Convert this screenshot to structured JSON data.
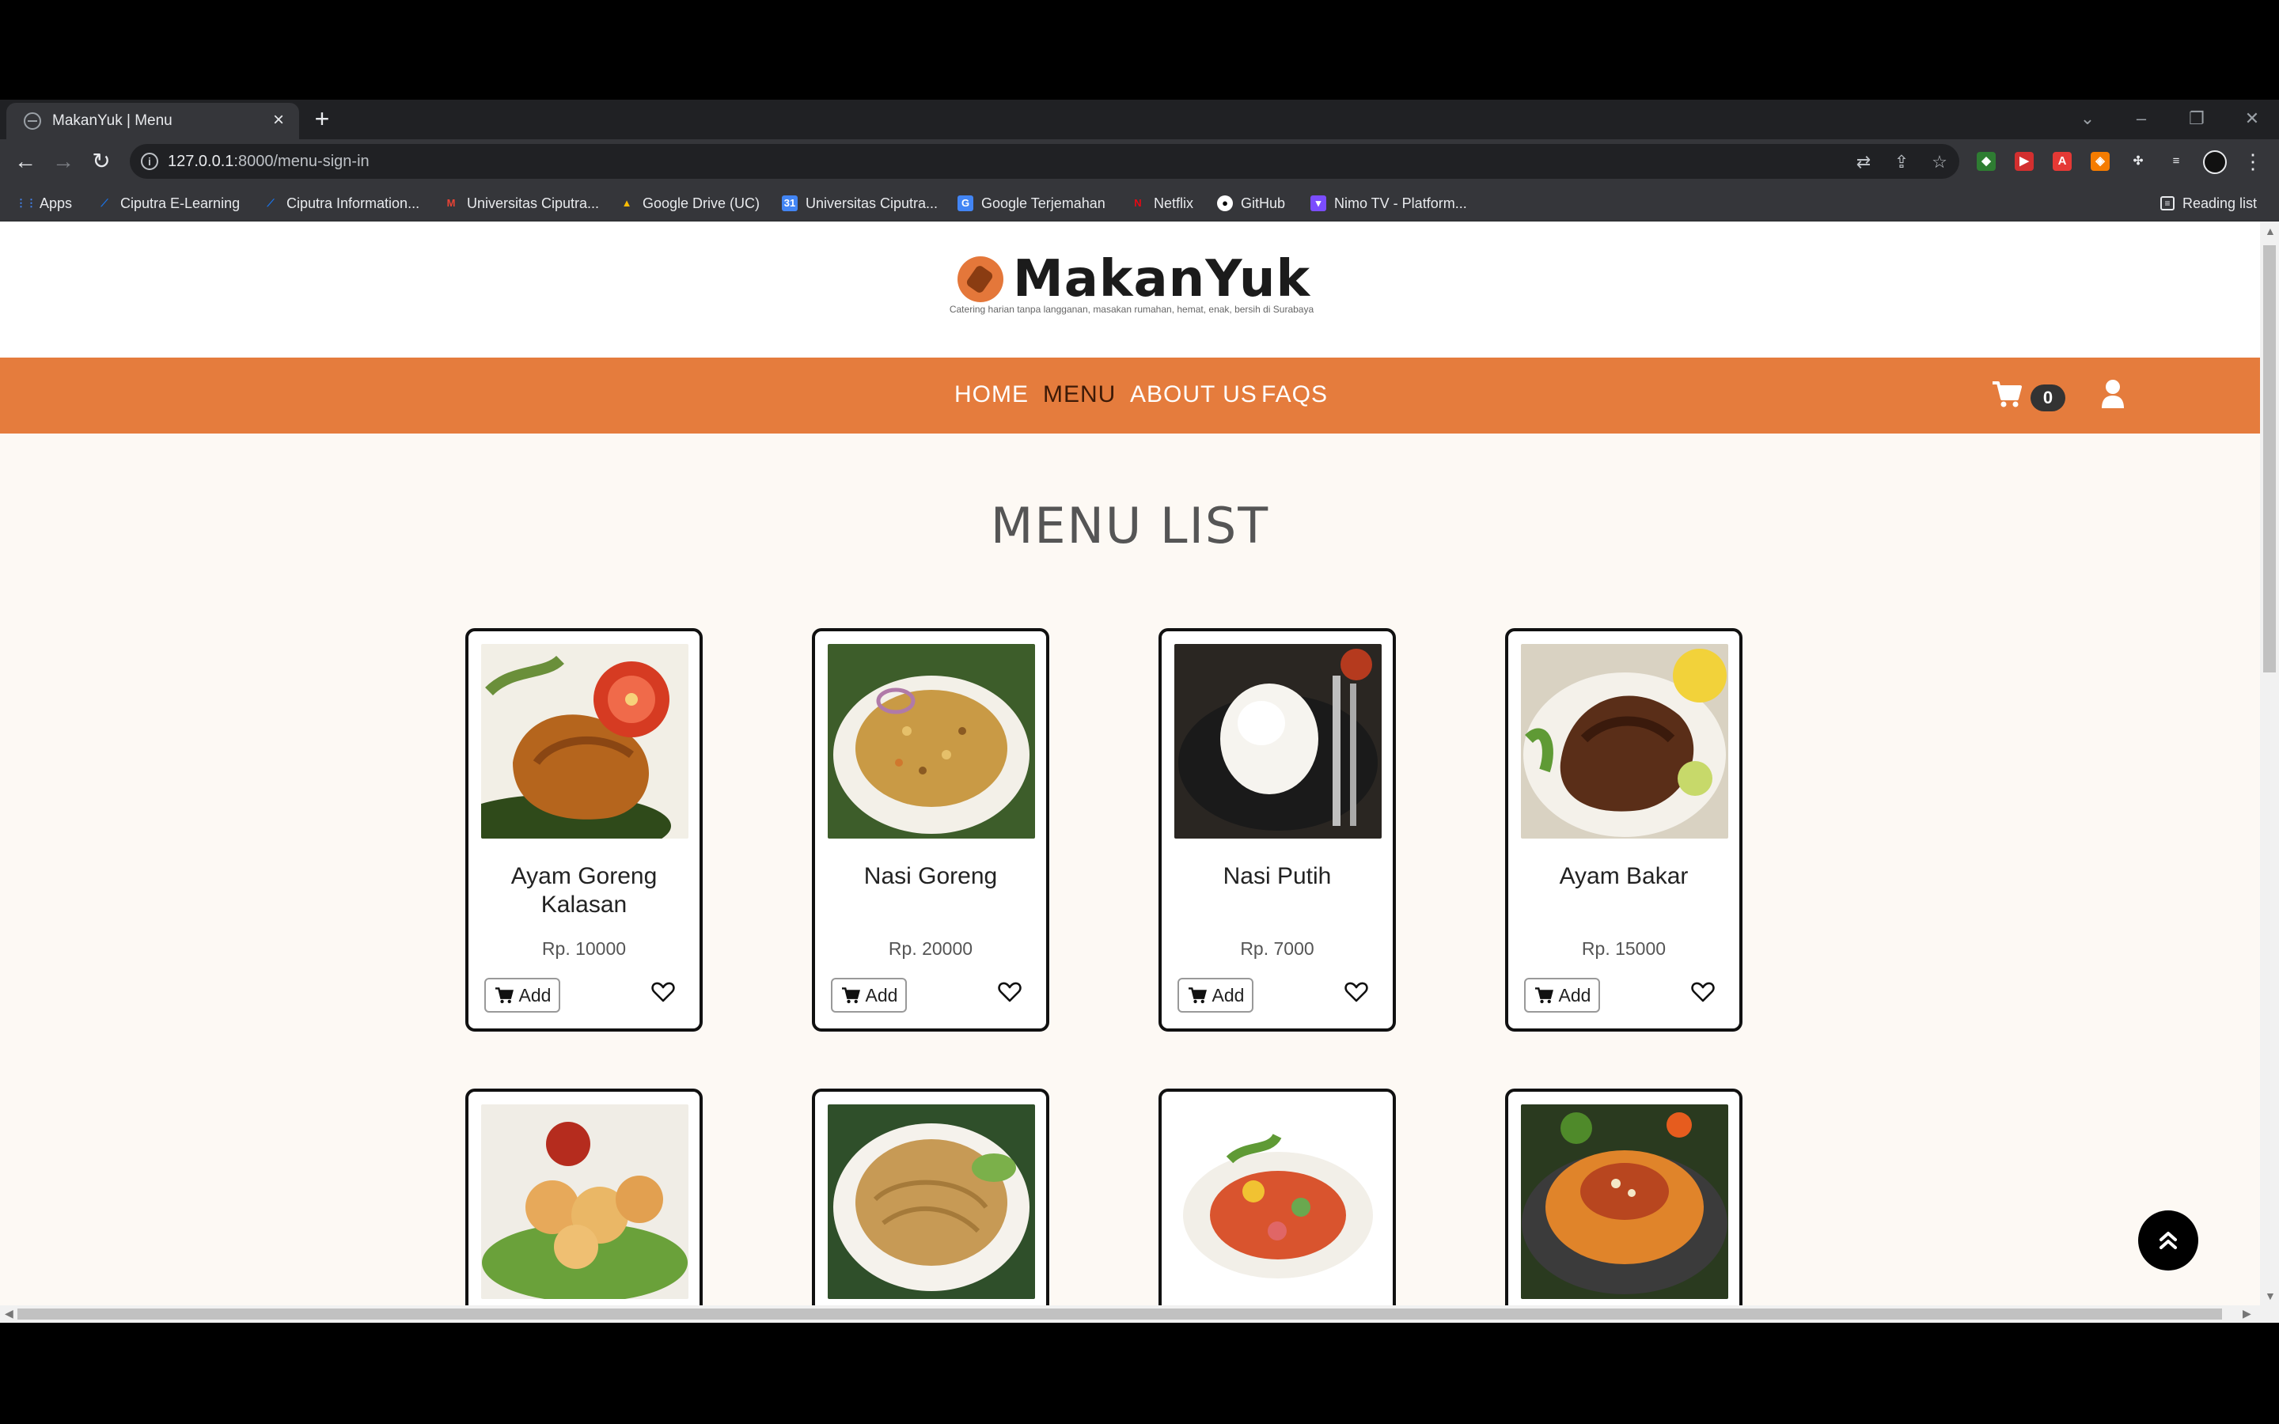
{
  "browser": {
    "tab_title": "MakanYuk | Menu",
    "url_host": "127.0.0.1",
    "url_path": ":8000/menu-sign-in",
    "bookmarks": [
      {
        "label": "Apps",
        "icon": "apps-grid-icon",
        "color": "#ea4335"
      },
      {
        "label": "Ciputra E-Learning",
        "icon": "ciputra-icon",
        "color": "#1a73e8"
      },
      {
        "label": "Ciputra Information...",
        "icon": "ciputra-icon",
        "color": "#1a73e8"
      },
      {
        "label": "Universitas Ciputra...",
        "icon": "gmail-icon",
        "color": "#ea4335"
      },
      {
        "label": "Google Drive (UC)",
        "icon": "google-drive-icon",
        "color": "#fbbc04"
      },
      {
        "label": "Universitas Ciputra...",
        "icon": "calendar-icon",
        "color": "#4285f4"
      },
      {
        "label": "Google Terjemahan",
        "icon": "google-translate-icon",
        "color": "#4285f4"
      },
      {
        "label": "Netflix",
        "icon": "netflix-icon",
        "color": "#e50914"
      },
      {
        "label": "GitHub",
        "icon": "github-icon",
        "color": "#ffffff"
      },
      {
        "label": "Nimo TV - Platform...",
        "icon": "nimo-tv-icon",
        "color": "#7b4dff"
      }
    ],
    "reading_list": "Reading list"
  },
  "site": {
    "brand": "MakanYuk",
    "tagline": "Catering harian tanpa langganan, masakan rumahan, hemat, enak, bersih di Surabaya",
    "accent_color": "#e57c3d",
    "nav": {
      "home": "HOME",
      "menu": "MENU",
      "about": "ABOUT US",
      "faqs": "FAQS",
      "active": "MENU"
    },
    "cart_count": "0"
  },
  "page": {
    "title": "MENU LIST",
    "add_label": "Add",
    "menu_items": [
      {
        "name": "Ayam Goreng Kalasan",
        "price": "Rp. 10000"
      },
      {
        "name": "Nasi Goreng",
        "price": "Rp. 20000"
      },
      {
        "name": "Nasi Putih",
        "price": "Rp. 7000"
      },
      {
        "name": "Ayam Bakar",
        "price": "Rp. 15000"
      }
    ]
  }
}
